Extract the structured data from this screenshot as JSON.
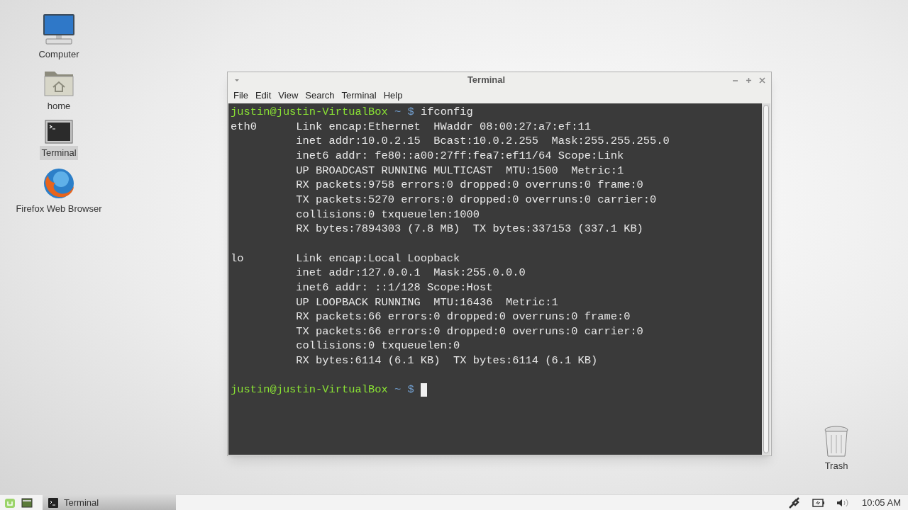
{
  "desktop_icons": [
    {
      "label": "Computer",
      "kind": "computer",
      "selected": false
    },
    {
      "label": "home",
      "kind": "folder",
      "selected": false
    },
    {
      "label": "Terminal",
      "kind": "terminal",
      "selected": true
    },
    {
      "label": "Firefox Web Browser",
      "kind": "browser",
      "selected": false
    }
  ],
  "trash": {
    "label": "Trash"
  },
  "window": {
    "title": "Terminal",
    "menu": [
      "File",
      "Edit",
      "View",
      "Search",
      "Terminal",
      "Help"
    ],
    "lines": [
      {
        "kind": "prompt",
        "user": "justin@justin-VirtualBox",
        "path": "~",
        "symbol": "$",
        "command": "ifconfig",
        "cursor": false
      },
      {
        "kind": "output",
        "text": "eth0      Link encap:Ethernet  HWaddr 08:00:27:a7:ef:11"
      },
      {
        "kind": "output",
        "text": "          inet addr:10.0.2.15  Bcast:10.0.2.255  Mask:255.255.255.0"
      },
      {
        "kind": "output",
        "text": "          inet6 addr: fe80::a00:27ff:fea7:ef11/64 Scope:Link"
      },
      {
        "kind": "output",
        "text": "          UP BROADCAST RUNNING MULTICAST  MTU:1500  Metric:1"
      },
      {
        "kind": "output",
        "text": "          RX packets:9758 errors:0 dropped:0 overruns:0 frame:0"
      },
      {
        "kind": "output",
        "text": "          TX packets:5270 errors:0 dropped:0 overruns:0 carrier:0"
      },
      {
        "kind": "output",
        "text": "          collisions:0 txqueuelen:1000"
      },
      {
        "kind": "output",
        "text": "          RX bytes:7894303 (7.8 MB)  TX bytes:337153 (337.1 KB)"
      },
      {
        "kind": "blank"
      },
      {
        "kind": "output",
        "text": "lo        Link encap:Local Loopback"
      },
      {
        "kind": "output",
        "text": "          inet addr:127.0.0.1  Mask:255.0.0.0"
      },
      {
        "kind": "output",
        "text": "          inet6 addr: ::1/128 Scope:Host"
      },
      {
        "kind": "output",
        "text": "          UP LOOPBACK RUNNING  MTU:16436  Metric:1"
      },
      {
        "kind": "output",
        "text": "          RX packets:66 errors:0 dropped:0 overruns:0 frame:0"
      },
      {
        "kind": "output",
        "text": "          TX packets:66 errors:0 dropped:0 overruns:0 carrier:0"
      },
      {
        "kind": "output",
        "text": "          collisions:0 txqueuelen:0"
      },
      {
        "kind": "output",
        "text": "          RX bytes:6114 (6.1 KB)  TX bytes:6114 (6.1 KB)"
      },
      {
        "kind": "blank"
      },
      {
        "kind": "prompt",
        "user": "justin@justin-VirtualBox",
        "path": "~",
        "symbol": "$",
        "cursor": true
      }
    ]
  },
  "taskbar": {
    "tasks": [
      {
        "label": "Terminal",
        "selected": true
      }
    ],
    "clock": "10:05 AM"
  }
}
